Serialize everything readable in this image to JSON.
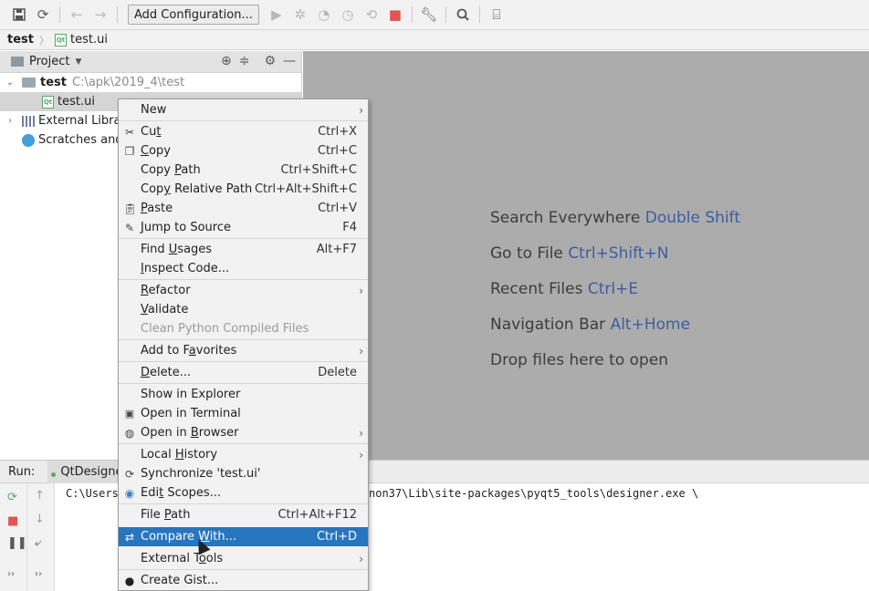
{
  "toolbar": {
    "config_label": "Add Configuration...",
    "icons": [
      "save-icon",
      "sync-icon",
      "back-icon",
      "forward-icon",
      "run-icon",
      "debug-icon",
      "coverage-icon",
      "profile-icon",
      "rerun-icon",
      "stop-icon",
      "wrench-icon",
      "search-icon",
      "vcs-icon"
    ]
  },
  "breadcrumb": {
    "project": "test",
    "file": "test.ui"
  },
  "project_panel": {
    "title": "Project",
    "tree": {
      "root_name": "test",
      "root_path": "C:\\apk\\2019_4\\test",
      "file": "test.ui",
      "external_libs": "External Librari",
      "scratches": "Scratches and C"
    }
  },
  "editor": {
    "hints": [
      {
        "text": "Search Everywhere",
        "key": "Double Shift"
      },
      {
        "text": "Go to File",
        "key": "Ctrl+Shift+N"
      },
      {
        "text": "Recent Files",
        "key": "Ctrl+E"
      },
      {
        "text": "Navigation Bar",
        "key": "Alt+Home"
      },
      {
        "text": "Drop files here to open",
        "key": ""
      }
    ]
  },
  "run_panel": {
    "label": "Run:",
    "tab": "QtDesigne",
    "console_left": "C:\\Users",
    "console_right": "non37\\Lib\\site-packages\\pyqt5_tools\\designer.exe \\"
  },
  "context_menu": {
    "items": {
      "new": {
        "label": "New"
      },
      "cut": {
        "pre": "Cu",
        "u": "t",
        "post": "",
        "shortcut": "Ctrl+X"
      },
      "copy": {
        "pre": "",
        "u": "C",
        "post": "opy",
        "shortcut": "Ctrl+C"
      },
      "copy_path": {
        "pre": "Copy ",
        "u": "P",
        "post": "ath",
        "shortcut": "Ctrl+Shift+C"
      },
      "copy_relative_path": {
        "pre": "Cop",
        "u": "y",
        "post": " Relative Path",
        "shortcut": "Ctrl+Alt+Shift+C"
      },
      "paste": {
        "pre": "",
        "u": "P",
        "post": "aste",
        "shortcut": "Ctrl+V"
      },
      "jump_to_source": {
        "pre": "",
        "u": "J",
        "post": "ump to Source",
        "shortcut": "F4"
      },
      "find_usages": {
        "pre": "Find ",
        "u": "U",
        "post": "sages",
        "shortcut": "Alt+F7"
      },
      "inspect_code": {
        "pre": "",
        "u": "I",
        "post": "nspect Code...",
        "shortcut": ""
      },
      "refactor": {
        "pre": "",
        "u": "R",
        "post": "efactor"
      },
      "validate": {
        "pre": "",
        "u": "V",
        "post": "alidate"
      },
      "clean_python": {
        "label": "Clean Python Compiled Files"
      },
      "add_to_favorites": {
        "pre": "Add to F",
        "u": "a",
        "post": "vorites"
      },
      "delete": {
        "pre": "",
        "u": "D",
        "post": "elete...",
        "shortcut": "Delete"
      },
      "show_in_explorer": {
        "label": "Show in Explorer"
      },
      "open_in_terminal": {
        "label": "Open in Terminal"
      },
      "open_in_browser": {
        "pre": "Open in ",
        "u": "B",
        "post": "rowser"
      },
      "local_history": {
        "pre": "Local ",
        "u": "H",
        "post": "istory"
      },
      "synchronize": {
        "label": "Synchronize 'test.ui'"
      },
      "edit_scopes": {
        "pre": "Edi",
        "u": "t",
        "post": " Scopes..."
      },
      "file_path": {
        "pre": "File ",
        "u": "P",
        "post": "ath",
        "shortcut": "Ctrl+Alt+F12"
      },
      "compare_with": {
        "pre": "Compare ",
        "u": "W",
        "post": "ith...",
        "shortcut": "Ctrl+D"
      },
      "external_tools": {
        "pre": "External T",
        "u": "o",
        "post": "ols"
      },
      "create_gist": {
        "label": "Create Gist..."
      }
    }
  },
  "colors": {
    "menu_highlight": "#2675bf",
    "editor_bg": "#acacac",
    "hint_key": "#3d5d9e"
  }
}
